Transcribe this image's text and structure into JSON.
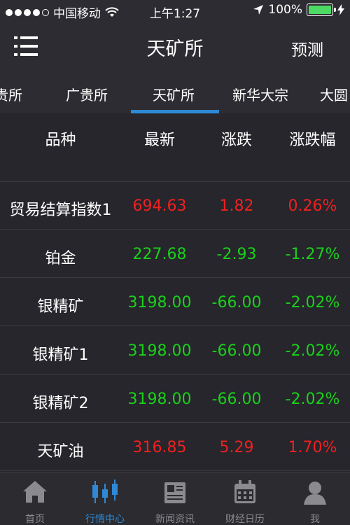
{
  "status": {
    "carrier": "中国移动",
    "time": "上午1:27",
    "battery": "100%"
  },
  "nav": {
    "title": "天矿所",
    "right": "预测"
  },
  "tabs": [
    "贵所",
    "广贵所",
    "天矿所",
    "新华大宗",
    "大圆"
  ],
  "active_tab": "天矿所",
  "header": {
    "name": "品种",
    "last": "最新",
    "change": "涨跌",
    "pct": "涨跌幅"
  },
  "rows": [
    {
      "name": "贸易结算指数1",
      "last": "694.63",
      "change": "1.82",
      "pct": "0.26%",
      "dir": "up"
    },
    {
      "name": "铂金",
      "last": "227.68",
      "change": "-2.93",
      "pct": "-1.27%",
      "dir": "down"
    },
    {
      "name": "银精矿",
      "last": "3198.00",
      "change": "-66.00",
      "pct": "-2.02%",
      "dir": "down"
    },
    {
      "name": "银精矿1",
      "last": "3198.00",
      "change": "-66.00",
      "pct": "-2.02%",
      "dir": "down"
    },
    {
      "name": "银精矿2",
      "last": "3198.00",
      "change": "-66.00",
      "pct": "-2.02%",
      "dir": "down"
    },
    {
      "name": "天矿油",
      "last": "316.85",
      "change": "5.29",
      "pct": "1.70%",
      "dir": "up"
    }
  ],
  "colors": {
    "up": "#f02020",
    "down": "#1bd01b",
    "accent": "#2f88d4"
  },
  "tabbar": [
    {
      "label": "首页",
      "icon": "home-icon"
    },
    {
      "label": "行情中心",
      "icon": "candlestick-icon"
    },
    {
      "label": "新闻资讯",
      "icon": "newspaper-icon"
    },
    {
      "label": "财经日历",
      "icon": "calendar-icon"
    },
    {
      "label": "我",
      "icon": "user-icon"
    }
  ],
  "active_tabbar": "行情中心"
}
